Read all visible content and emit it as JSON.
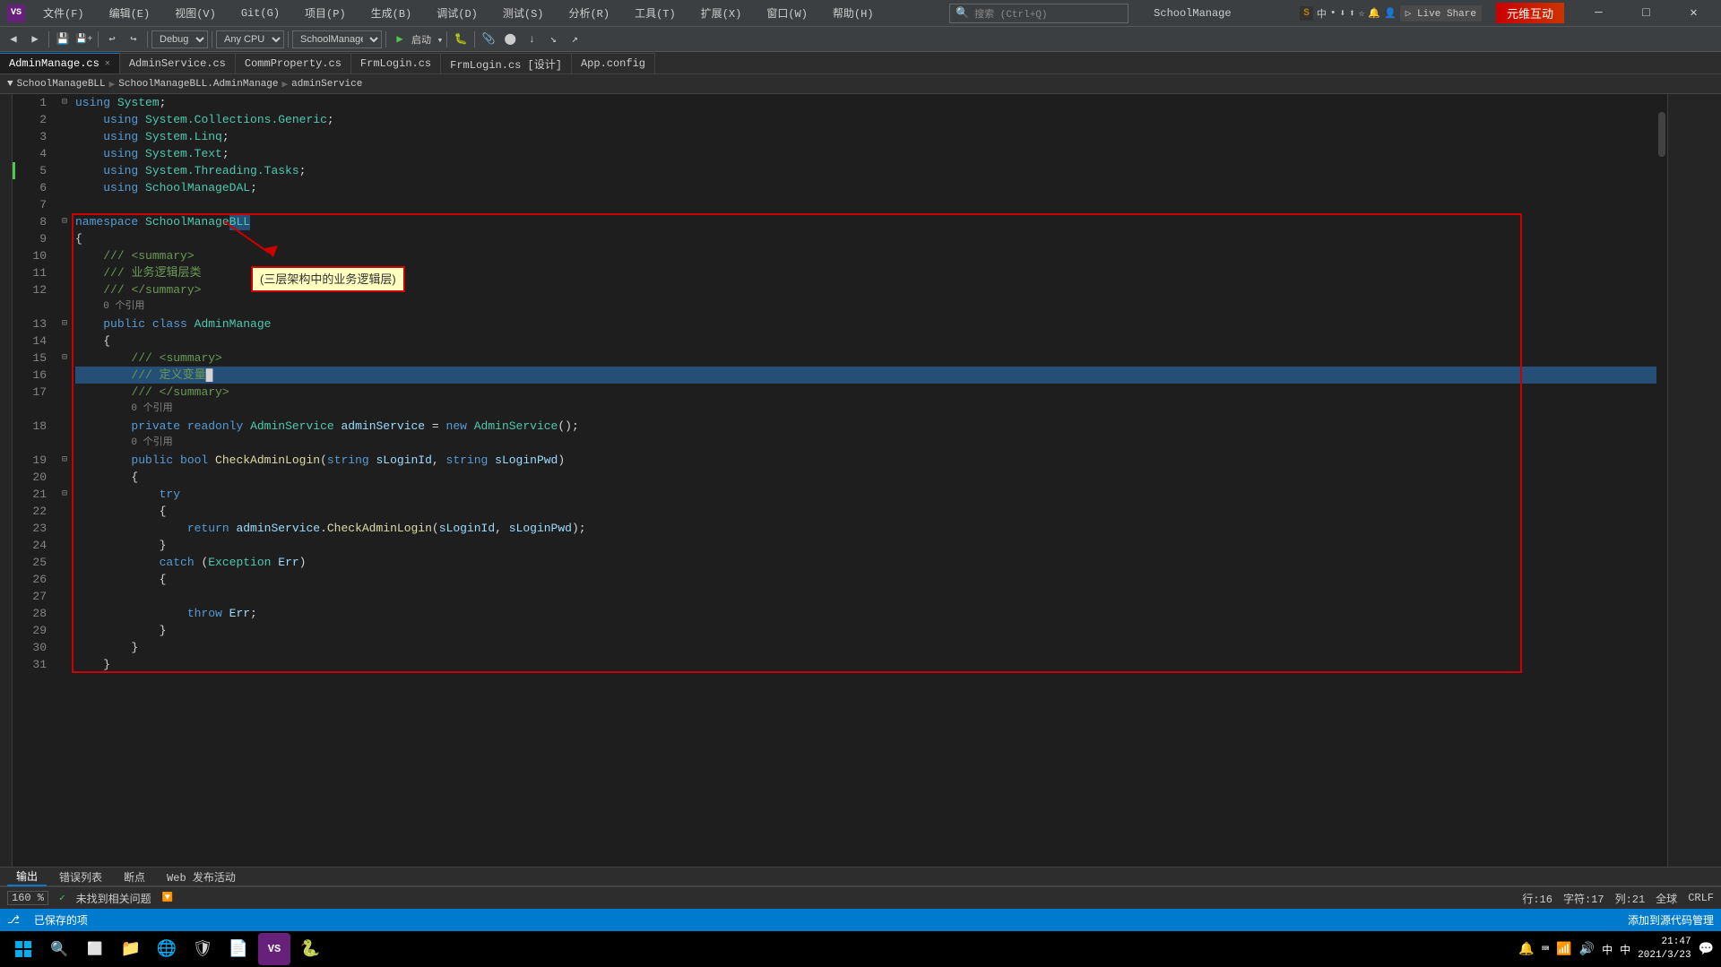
{
  "titlebar": {
    "title": "SchoolManage",
    "menu_items": [
      "文件(F)",
      "编辑(E)",
      "视图(V)",
      "Git(G)",
      "项目(P)",
      "生成(B)",
      "调试(D)",
      "测试(S)",
      "分析(R)",
      "工具(T)",
      "扩展(X)",
      "窗口(W)",
      "帮助(H)"
    ],
    "search_placeholder": "搜索 (Ctrl+Q)",
    "window_title": "SchoolManage",
    "min_btn": "─",
    "max_btn": "□",
    "close_btn": "✕"
  },
  "toolbar": {
    "config": "Debug",
    "platform": "Any CPU",
    "project": "SchoolManage"
  },
  "tabs": [
    {
      "label": "AdminManage.cs",
      "active": true,
      "modified": false
    },
    {
      "label": "AdminService.cs",
      "active": false
    },
    {
      "label": "CommProperty.cs",
      "active": false
    },
    {
      "label": "FrmLogin.cs",
      "active": false
    },
    {
      "label": "FrmLogin.cs [设计]",
      "active": false
    },
    {
      "label": "App.config",
      "active": false
    }
  ],
  "path_bar": {
    "left": "SchoolManageBLL",
    "middle": "SchoolManageBLL.AdminManage",
    "right": "adminService"
  },
  "code_lines": [
    {
      "num": "1",
      "fold": "⊟",
      "indent": 0,
      "tokens": [
        {
          "t": "using ",
          "c": "kw"
        },
        {
          "t": "System",
          "c": "type"
        },
        {
          "t": ";",
          "c": "plain"
        }
      ]
    },
    {
      "num": "2",
      "fold": "",
      "indent": 1,
      "tokens": [
        {
          "t": "using ",
          "c": "kw"
        },
        {
          "t": "System.Collections.Generic",
          "c": "type"
        },
        {
          "t": ";",
          "c": "plain"
        }
      ]
    },
    {
      "num": "3",
      "fold": "",
      "indent": 1,
      "tokens": [
        {
          "t": "using ",
          "c": "kw"
        },
        {
          "t": "System.Linq",
          "c": "type"
        },
        {
          "t": ";",
          "c": "plain"
        }
      ]
    },
    {
      "num": "4",
      "fold": "",
      "indent": 1,
      "tokens": [
        {
          "t": "using ",
          "c": "kw"
        },
        {
          "t": "System.Text",
          "c": "type"
        },
        {
          "t": ";",
          "c": "plain"
        }
      ]
    },
    {
      "num": "5",
      "fold": "",
      "indent": 1,
      "tokens": [
        {
          "t": "using ",
          "c": "kw"
        },
        {
          "t": "System.Threading.Tasks",
          "c": "type"
        },
        {
          "t": ";",
          "c": "plain"
        }
      ],
      "has_green": true
    },
    {
      "num": "6",
      "fold": "",
      "indent": 1,
      "tokens": [
        {
          "t": "using ",
          "c": "kw"
        },
        {
          "t": "SchoolManageDAL",
          "c": "type"
        },
        {
          "t": ";",
          "c": "plain"
        }
      ]
    },
    {
      "num": "7",
      "fold": "",
      "indent": 0,
      "tokens": []
    },
    {
      "num": "8",
      "fold": "⊟",
      "indent": 0,
      "tokens": [
        {
          "t": "namespace ",
          "c": "kw"
        },
        {
          "t": "SchoolManage",
          "c": "type"
        },
        {
          "t": "BLL",
          "c": "selected-text"
        }
      ]
    },
    {
      "num": "9",
      "fold": "",
      "indent": 0,
      "tokens": [
        {
          "t": "{",
          "c": "plain"
        }
      ]
    },
    {
      "num": "10",
      "fold": "",
      "indent": 1,
      "tokens": [
        {
          "t": "/// ",
          "c": "comment"
        },
        {
          "t": "<summary>",
          "c": "comment"
        }
      ]
    },
    {
      "num": "11",
      "fold": "",
      "indent": 1,
      "tokens": [
        {
          "t": "/// ",
          "c": "comment"
        },
        {
          "t": "业务逻辑层类",
          "c": "comment"
        }
      ],
      "annotation": "(三层架构中的业务逻辑层)"
    },
    {
      "num": "12",
      "fold": "",
      "indent": 1,
      "tokens": [
        {
          "t": "/// ",
          "c": "comment"
        },
        {
          "t": "</summary>",
          "c": "comment"
        }
      ]
    },
    {
      "num": "",
      "fold": "",
      "indent": 1,
      "tokens": [
        {
          "t": "0 个引用",
          "c": "ref-count"
        }
      ]
    },
    {
      "num": "13",
      "fold": "⊟",
      "indent": 1,
      "tokens": [
        {
          "t": "public ",
          "c": "kw"
        },
        {
          "t": "class ",
          "c": "kw"
        },
        {
          "t": "AdminManage",
          "c": "type"
        }
      ]
    },
    {
      "num": "14",
      "fold": "",
      "indent": 1,
      "tokens": [
        {
          "t": "{",
          "c": "plain"
        }
      ]
    },
    {
      "num": "15",
      "fold": "⊟",
      "indent": 2,
      "tokens": [
        {
          "t": "/// ",
          "c": "comment"
        },
        {
          "t": "<summary>",
          "c": "comment"
        }
      ]
    },
    {
      "num": "16",
      "fold": "",
      "indent": 2,
      "tokens": [
        {
          "t": "/// ",
          "c": "comment"
        },
        {
          "t": "定义变量",
          "c": "comment"
        },
        {
          "t": "█",
          "c": "plain"
        }
      ],
      "highlight": true
    },
    {
      "num": "17",
      "fold": "",
      "indent": 2,
      "tokens": [
        {
          "t": "/// ",
          "c": "comment"
        },
        {
          "t": "</summary>",
          "c": "comment"
        }
      ]
    },
    {
      "num": "",
      "fold": "",
      "indent": 2,
      "tokens": [
        {
          "t": "0 个引用",
          "c": "ref-count"
        }
      ]
    },
    {
      "num": "18",
      "fold": "",
      "indent": 2,
      "tokens": [
        {
          "t": "private ",
          "c": "kw"
        },
        {
          "t": "readonly ",
          "c": "kw"
        },
        {
          "t": "AdminService ",
          "c": "type"
        },
        {
          "t": "adminService ",
          "c": "var"
        },
        {
          "t": "= ",
          "c": "plain"
        },
        {
          "t": "new ",
          "c": "kw"
        },
        {
          "t": "AdminService",
          "c": "type"
        },
        {
          "t": "();",
          "c": "plain"
        }
      ]
    },
    {
      "num": "",
      "fold": "",
      "indent": 2,
      "tokens": [
        {
          "t": "0 个引用",
          "c": "ref-count"
        }
      ]
    },
    {
      "num": "19",
      "fold": "⊟",
      "indent": 2,
      "tokens": [
        {
          "t": "public ",
          "c": "kw"
        },
        {
          "t": "bool ",
          "c": "kw"
        },
        {
          "t": "CheckAdminLogin",
          "c": "method"
        },
        {
          "t": "(",
          "c": "plain"
        },
        {
          "t": "string ",
          "c": "kw"
        },
        {
          "t": "sLoginId",
          "c": "var"
        },
        {
          "t": ", ",
          "c": "plain"
        },
        {
          "t": "string ",
          "c": "kw"
        },
        {
          "t": "sLoginPwd",
          "c": "var"
        },
        {
          "t": ")",
          "c": "plain"
        }
      ]
    },
    {
      "num": "20",
      "fold": "",
      "indent": 2,
      "tokens": [
        {
          "t": "{",
          "c": "plain"
        }
      ]
    },
    {
      "num": "21",
      "fold": "⊟",
      "indent": 3,
      "tokens": [
        {
          "t": "try",
          "c": "kw"
        }
      ]
    },
    {
      "num": "22",
      "fold": "",
      "indent": 3,
      "tokens": [
        {
          "t": "{",
          "c": "plain"
        }
      ]
    },
    {
      "num": "23",
      "fold": "",
      "indent": 4,
      "tokens": [
        {
          "t": "return ",
          "c": "kw"
        },
        {
          "t": "adminService",
          "c": "var"
        },
        {
          "t": ".",
          "c": "plain"
        },
        {
          "t": "CheckAdminLogin",
          "c": "method"
        },
        {
          "t": "(",
          "c": "plain"
        },
        {
          "t": "sLoginId",
          "c": "var"
        },
        {
          "t": ", ",
          "c": "plain"
        },
        {
          "t": "sLoginPwd",
          "c": "var"
        },
        {
          "t": ");",
          "c": "plain"
        }
      ]
    },
    {
      "num": "24",
      "fold": "",
      "indent": 3,
      "tokens": [
        {
          "t": "}",
          "c": "plain"
        }
      ]
    },
    {
      "num": "25",
      "fold": "",
      "indent": 3,
      "tokens": [
        {
          "t": "catch ",
          "c": "kw"
        },
        {
          "t": "(",
          "c": "plain"
        },
        {
          "t": "Exception ",
          "c": "type"
        },
        {
          "t": "Err",
          "c": "var"
        },
        {
          "t": ")",
          "c": "plain"
        }
      ]
    },
    {
      "num": "26",
      "fold": "",
      "indent": 3,
      "tokens": [
        {
          "t": "{",
          "c": "plain"
        }
      ]
    },
    {
      "num": "27",
      "fold": "",
      "indent": 4,
      "tokens": []
    },
    {
      "num": "28",
      "fold": "",
      "indent": 4,
      "tokens": [
        {
          "t": "throw ",
          "c": "kw"
        },
        {
          "t": "Err",
          "c": "var"
        },
        {
          "t": ";",
          "c": "plain"
        }
      ]
    },
    {
      "num": "29",
      "fold": "",
      "indent": 3,
      "tokens": [
        {
          "t": "}",
          "c": "plain"
        }
      ]
    },
    {
      "num": "30",
      "fold": "",
      "indent": 2,
      "tokens": [
        {
          "t": "}",
          "c": "plain"
        }
      ]
    },
    {
      "num": "31",
      "fold": "",
      "indent": 1,
      "tokens": [
        {
          "t": "}",
          "c": "plain"
        }
      ]
    }
  ],
  "annotation": {
    "text": "(三层架构中的业务逻辑层)",
    "tooltip_text": "BLL"
  },
  "bottom_tabs": [
    "输出",
    "错误列表",
    "断点",
    "Web 发布活动"
  ],
  "status": {
    "zoom": "160 %",
    "errors": "未找到相关问题",
    "row": "行:16",
    "col": "字符:17",
    "pos": "列:21",
    "encoding": "全球",
    "line_ending": "CRLF"
  },
  "statusbar_bottom": {
    "ready": "已保存的项",
    "add_code": "添加到源代码管理"
  },
  "taskbar": {
    "time": "21:47",
    "date": "2021/3/23",
    "icons": [
      "⊞",
      "⬜",
      "📁",
      "🌐",
      "🛡",
      "📝",
      "💙"
    ]
  },
  "right_panel": {
    "share_label": "Share"
  },
  "csdn": {
    "watermark": "元维互动"
  }
}
